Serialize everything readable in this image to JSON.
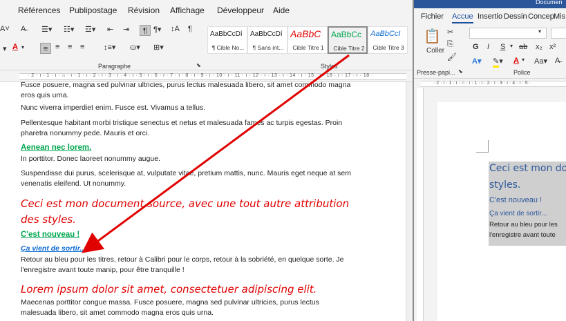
{
  "left_window": {
    "menu": [
      "Références",
      "Publipostage",
      "Révision",
      "Affichage",
      "Développeur",
      "Aide"
    ],
    "groups": {
      "paragraph": "Paragraphe",
      "styles": "Styles"
    },
    "styles": [
      {
        "preview": "AaBbCcDí",
        "caption": "¶ Cible No..."
      },
      {
        "preview": "AaBbCcDí",
        "caption": "¶ Sans int..."
      },
      {
        "preview": "AaBbC",
        "caption": "Cible Titre 1"
      },
      {
        "preview": "AaBbCc",
        "caption": "Cible Titre 2"
      },
      {
        "preview": "AaBbCcI",
        "caption": "Cible Titre 3"
      }
    ],
    "ruler_ticks": "· 2 · ı · 1 · ı · ⌂ · ı · 1 · ı · 2 · ı · 3 · ı · 4 · ı · 5 · ı · 6 · ı · 7 · ı · 8 · ı · 9 · ı · 10 · ı · 11 · ı · 12 · ı · 13 · ı · 14 · ı · 15 · ı · 16 · ı · 17 · ı · 18 ·",
    "document": {
      "p0": "Fusce posuere, magna sed pulvinar ultricies, purus lectus malesuada libero, sit amet commodo magna eros quis urna.",
      "p1": "Nunc viverra imperdiet enim. Fusce est. Vivamus a tellus.",
      "p2": "Pellentesque habitant morbi tristique senectus et netus et malesuada fames ac turpis egestas. Proin pharetra nonummy pede. Mauris et orci.",
      "h_green1": "Aenean nec lorem.",
      "p3": "In porttitor. Donec laoreet nonummy augue.",
      "p4": "Suspendisse dui purus, scelerisque at, vulputate vitae, pretium mattis, nunc. Mauris eget neque at sem venenatis eleifend. Ut nonummy.",
      "h_red1": "Ceci est mon document source, avec une tout autre attribution des styles.",
      "h_green2": "C'est nouveau !",
      "h_blue": "Ça vient de sortir...",
      "p5": "Retour au bleu pour les titres, retour à Calibri pour le corps, retour à la sobriété, en quelque sorte. Je l'enregistre avant toute manip, pour être tranquille !",
      "h_red2": "Lorem ipsum dolor sit amet, consectetuer adipiscing elit.",
      "p6": "Maecenas porttitor congue massa. Fusce posuere, magna sed pulvinar ultricies, purus lectus malesuada libero, sit amet commodo magna eros quis urna."
    }
  },
  "right_window": {
    "title": "Documen",
    "tabs": [
      "Fichier",
      "Accue",
      "Insertio",
      "Dessin",
      "Concep",
      "Mis"
    ],
    "active_tab": "Accue",
    "paste_label": "Coller",
    "groups": {
      "clipboard": "Presse-papi...",
      "font": "Police"
    },
    "format_buttons": [
      "G",
      "I",
      "S",
      "ab",
      "x₂",
      "x²"
    ],
    "ruler_ticks": "· 2 · ı · 1 · ı · ⌂ · ı · 1 · ı · 2 · ı · 3 · ı · 4 · ı · 5 ·",
    "document": {
      "h1a": "Ceci est mon doc",
      "h1b": "styles.",
      "h2": "C'est nouveau !",
      "h3": "Ça vient de sortir...",
      "body1": "Retour au bleu pour les",
      "body2": "l'enregistre avant toute"
    }
  },
  "colors": {
    "green_heading": "#00a650",
    "red_heading": "#e00000",
    "blue_heading": "#0b6bd3",
    "arrow": "#e00000",
    "accent": "#2b579a"
  }
}
